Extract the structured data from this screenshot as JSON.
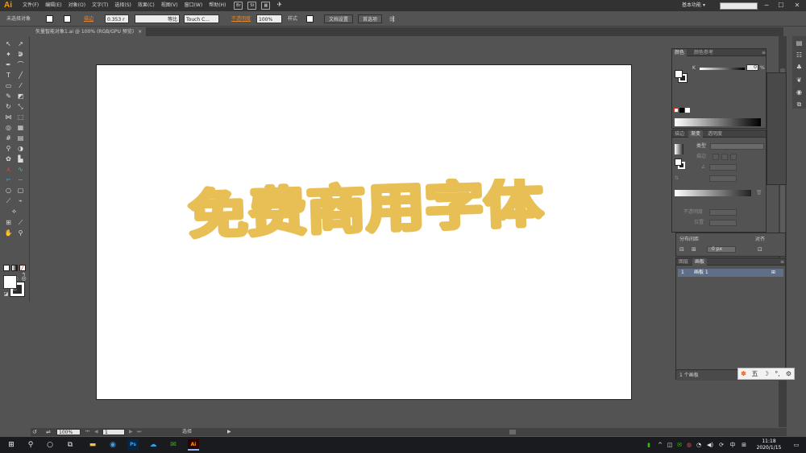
{
  "app": {
    "logo": "Ai"
  },
  "menu": [
    "文件(F)",
    "编辑(E)",
    "对象(O)",
    "文字(T)",
    "选择(S)",
    "效果(C)",
    "视图(V)",
    "窗口(W)",
    "帮助(H)"
  ],
  "menubar_icons": {
    "br": "Br",
    "st": "St"
  },
  "workspace": {
    "label": "基本功能",
    "caret": "▾"
  },
  "window_controls": {
    "minimize": "─",
    "maximize": "☐",
    "close": "✕"
  },
  "control_bar": {
    "selection_status": "未选择对象",
    "stroke_label": "描边",
    "stroke_weight": "0.353 r",
    "stroke_profile": "等比",
    "brush": "Touch C...",
    "opacity_label": "不透明度",
    "opacity_value": "100%",
    "style_label": "样式",
    "doc_setup": "文档设置",
    "preferences": "首选项"
  },
  "document_tab": {
    "title": "矢量智能对象1.ai @ 100% (RGB/GPU 预览)",
    "close": "×"
  },
  "artwork": {
    "text": "免费商用字体",
    "color": "#e8bf55"
  },
  "status_bar": {
    "zoom": "100%",
    "artboard_number": "1",
    "tool": "选择"
  },
  "color_panel": {
    "tabs": [
      "颜色",
      "颜色参考"
    ],
    "channel": "K",
    "value": "0",
    "unit": "%"
  },
  "gradient_panel": {
    "tabs": [
      "描边",
      "渐变",
      "透明度"
    ],
    "type_label": "类型",
    "stroke_label": "描边",
    "opacity_label": "不透明度",
    "location_label": "位置"
  },
  "align_panel": {
    "distribute_spacing": "分布间距",
    "align_to": "对齐",
    "spacing_value": "0 px"
  },
  "artboards_panel": {
    "tabs": [
      "图层",
      "画板"
    ],
    "rows": [
      {
        "number": "1",
        "name": "画板 1"
      }
    ],
    "footer": "1 个画板"
  },
  "ime": {
    "mode": "五",
    "moon": "☽",
    "punct": "°,",
    "settings": "⚙"
  },
  "taskbar": {
    "time": "11:18",
    "date": "2020/1/15",
    "input_lang": "中",
    "ps_label": "Ps",
    "ai_label": "Ai"
  }
}
